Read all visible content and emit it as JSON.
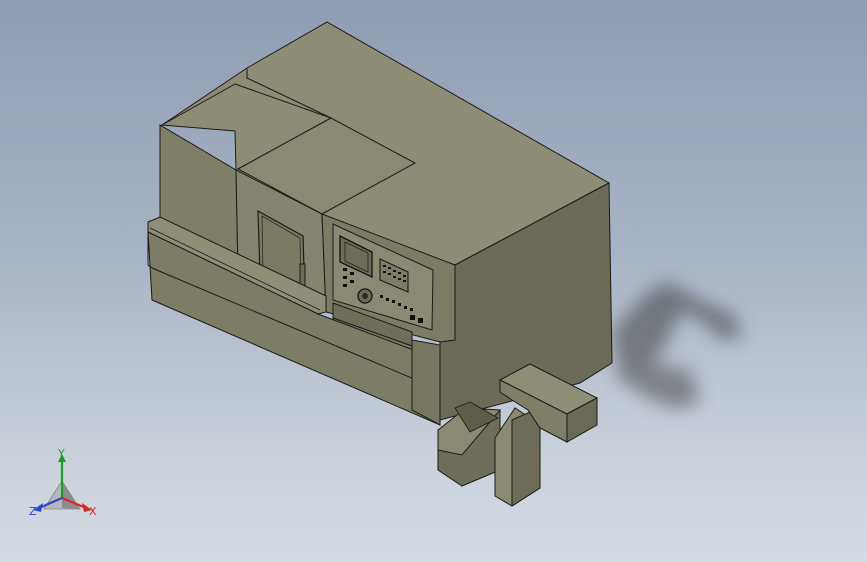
{
  "viewport": {
    "background_top": "#8f9db4",
    "background_bottom": "#d6dbe3",
    "model_color": "#807f67"
  },
  "triad": {
    "x_label": "X",
    "y_label": "Y",
    "z_label": "Z",
    "x_color": "#d8262e",
    "y_color": "#1f9a2a",
    "z_color": "#2c46c8"
  }
}
